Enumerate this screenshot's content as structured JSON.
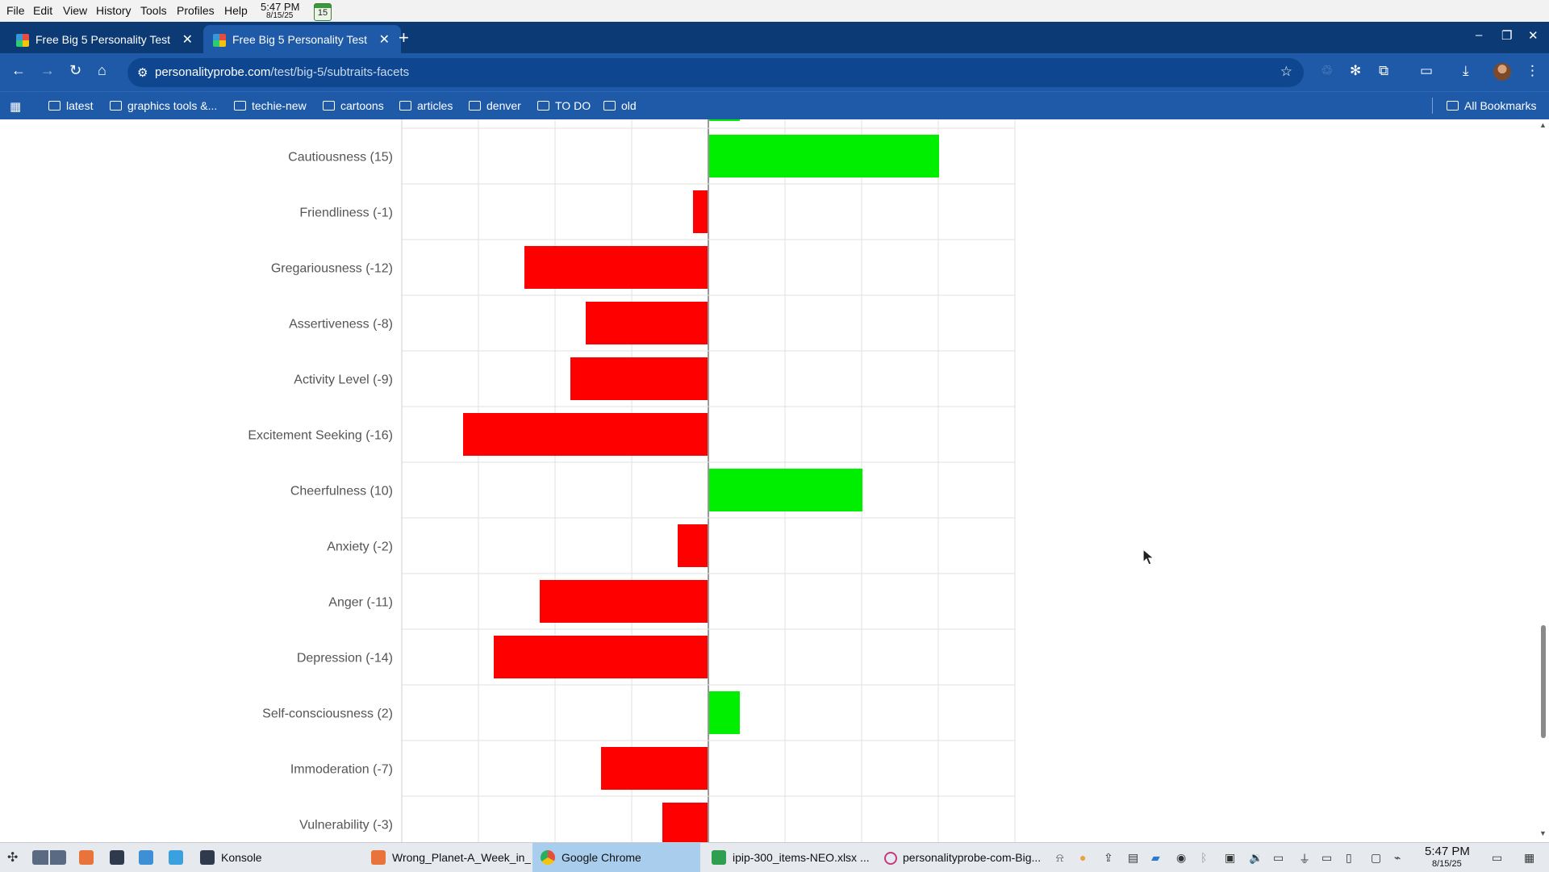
{
  "menubar": {
    "items": [
      "File",
      "Edit",
      "View",
      "History",
      "Tools",
      "Profiles",
      "Help"
    ],
    "clock_time": "5:47 PM",
    "clock_date": "8/15/25",
    "calendar_day": "15"
  },
  "tabs": [
    {
      "title": "Free Big 5 Personality Test",
      "active": false
    },
    {
      "title": "Free Big 5 Personality Test",
      "active": true
    }
  ],
  "toolbar": {
    "url_host": "personalityprobe.com",
    "url_path": "/test/big-5/subtraits-facets"
  },
  "bookmarks": {
    "items": [
      "latest",
      "graphics tools &...",
      "techie-new",
      "cartoons",
      "articles",
      "denver",
      "TO DO",
      "old"
    ],
    "all_bookmarks": "All Bookmarks"
  },
  "colors": {
    "positive": "#00ee00",
    "negative": "#ff0000",
    "chrome_dark": "#0b3a75",
    "chrome": "#1e5aa8"
  },
  "chart_data": {
    "type": "bar",
    "orientation": "horizontal",
    "categories": [
      "Cautiousness (15)",
      "Friendliness (-1)",
      "Gregariousness (-12)",
      "Assertiveness (-8)",
      "Activity Level (-9)",
      "Excitement Seeking (-16)",
      "Cheerfulness (10)",
      "Anxiety (-2)",
      "Anger (-11)",
      "Depression (-14)",
      "Self-consciousness (2)",
      "Immoderation (-7)",
      "Vulnerability (-3)"
    ],
    "values": [
      15,
      -1,
      -12,
      -8,
      -9,
      -16,
      10,
      -2,
      -11,
      -14,
      2,
      -7,
      -3
    ],
    "xlim": [
      -20,
      20
    ],
    "x_grid_step": 5,
    "grid": true,
    "partial_bar_above_value": 2
  },
  "taskbar": {
    "tasks": [
      {
        "label": "Konsole",
        "active": false
      },
      {
        "label": "Wrong_Planet-A_Week_in_...",
        "active": false
      },
      {
        "label": "Google Chrome",
        "active": true
      },
      {
        "label": "ipip-300_items-NEO.xlsx ...",
        "active": false
      },
      {
        "label": "personalityprobe-com-Big...",
        "active": false
      }
    ],
    "time": "5:47 PM",
    "date": "8/15/25"
  }
}
